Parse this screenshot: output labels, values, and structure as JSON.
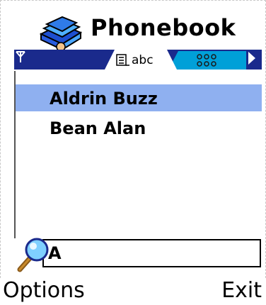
{
  "header": {
    "title": "Phonebook",
    "icon": "phonebook-icon"
  },
  "tabs": {
    "active_label": "abc",
    "active_icon": "list-icon",
    "inactive_icon": "groups-icon"
  },
  "contacts": [
    {
      "name": "Aldrin Buzz",
      "selected": true
    },
    {
      "name": "Bean Alan",
      "selected": false
    }
  ],
  "search": {
    "value": "A",
    "icon": "magnifier-icon"
  },
  "softkeys": {
    "left": "Options",
    "right": "Exit"
  },
  "colors": {
    "nav_bar": "#1a2a8c",
    "tab_inactive": "#00a0d8",
    "selection": "#8fb0f0"
  }
}
